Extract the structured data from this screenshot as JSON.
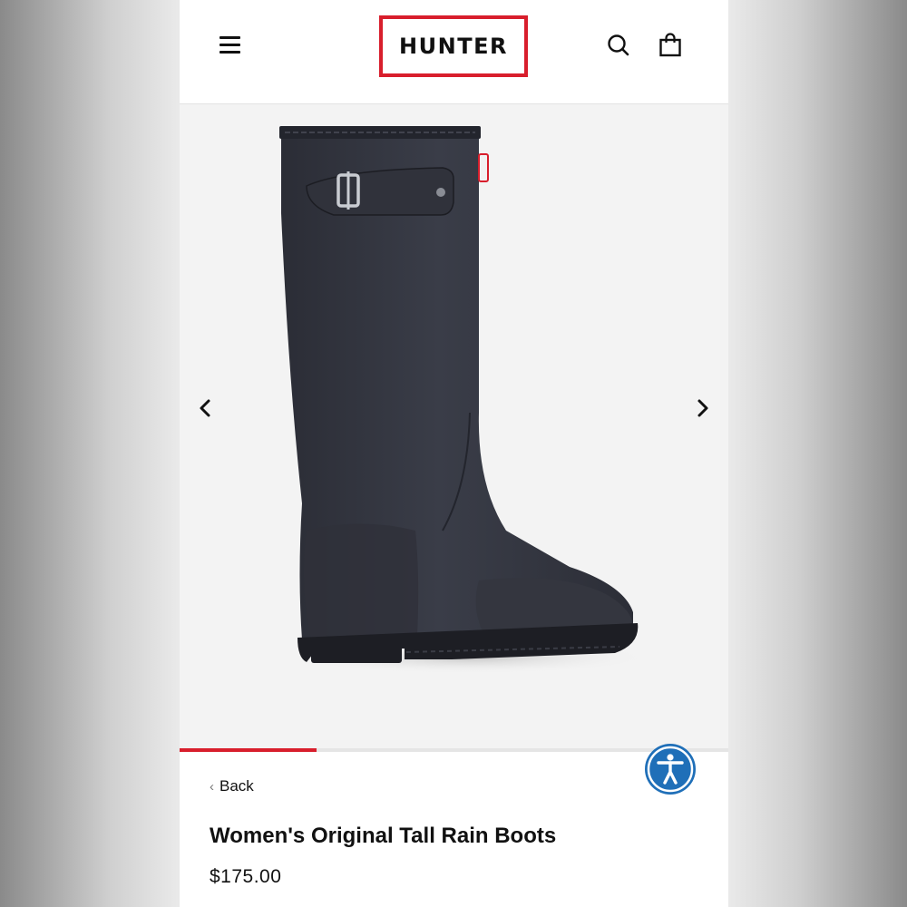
{
  "header": {
    "logo_text": "HUNTER",
    "brand_color": "#d81e2c",
    "menu_icon": "hamburger-menu-icon",
    "search_icon": "search-icon",
    "cart_icon": "shopping-bag-icon"
  },
  "gallery": {
    "image_subject": "navy tall rain boot",
    "prev_icon": "chevron-left-icon",
    "next_icon": "chevron-right-icon",
    "progress": 0.25
  },
  "accessibility": {
    "icon": "accessibility-icon",
    "color": "#1f6fb8"
  },
  "product": {
    "back_label": "Back",
    "title": "Women's Original Tall Rain Boots",
    "price": "$175.00"
  }
}
